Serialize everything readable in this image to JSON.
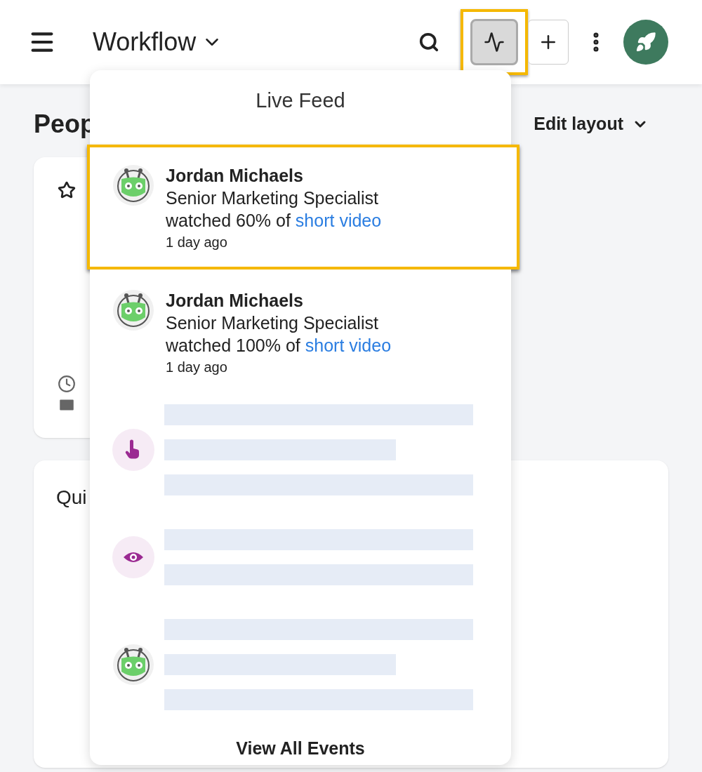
{
  "header": {
    "title": "Workflow",
    "activity_button": {
      "selected": true,
      "highlighted": true
    }
  },
  "page": {
    "title": "Peop",
    "edit_layout": "Edit layout",
    "card_title": "Qui"
  },
  "live_feed": {
    "title": "Live Feed",
    "footer": "View All Events",
    "items": [
      {
        "kind": "event",
        "avatar": {
          "kind": "robot"
        },
        "name": "Jordan Michaels",
        "job_title": "Senior Marketing Specialist",
        "action": "watched 60% of",
        "link": "short video",
        "time": "1 day ago",
        "highlighted": true
      },
      {
        "kind": "event",
        "avatar": {
          "kind": "robot"
        },
        "name": "Jordan Michaels",
        "job_title": "Senior Marketing Specialist",
        "action": "watched 100% of",
        "link": "short video",
        "time": "1 day ago",
        "highlighted": false
      },
      {
        "kind": "placeholder",
        "avatar": {
          "kind": "pointer"
        },
        "lines": [
          {
            "kind": "full"
          },
          {
            "kind": "short"
          },
          {
            "kind": "full"
          }
        ]
      },
      {
        "kind": "placeholder",
        "avatar": {
          "kind": "eye"
        },
        "lines": [
          {
            "kind": "full"
          },
          {
            "kind": "full"
          }
        ]
      },
      {
        "kind": "placeholder",
        "avatar": {
          "kind": "robot"
        },
        "lines": [
          {
            "kind": "full"
          },
          {
            "kind": "short"
          },
          {
            "kind": "full"
          }
        ]
      }
    ]
  }
}
